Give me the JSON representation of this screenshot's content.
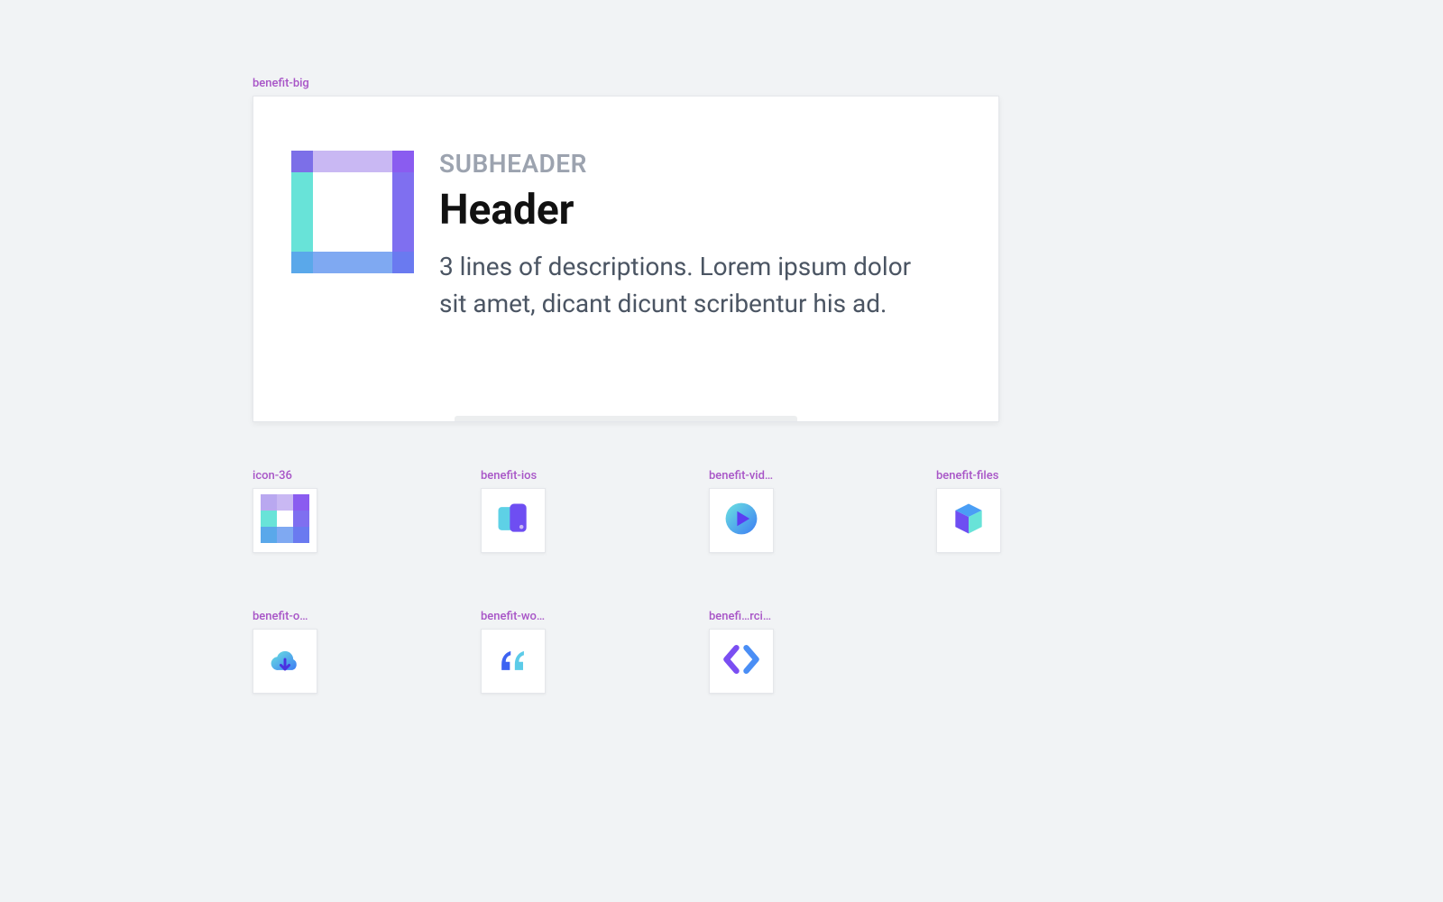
{
  "labels": {
    "benefit_big": "benefit-big",
    "icon_36": "icon-36",
    "benefit_ios": "benefit-ios",
    "benefit_video": "benefit-video",
    "benefit_files": "benefit-files",
    "benefit_offline": "benefit-offline",
    "benefit_words": "benefit-words",
    "benefit_exercises": "benefi…rcises"
  },
  "big": {
    "subheader": "SUBHEADER",
    "header": "Header",
    "description": "3 lines of descriptions. Lorem ipsum dolor sit amet, dicant dicunt scribentur his ad."
  },
  "icons": {
    "square_grid": "square-grid-icon",
    "pixel_grid": "pixel-grid-icon",
    "ios_cards": "ios-cards-icon",
    "play": "play-icon",
    "cube": "cube-icon",
    "cloud_download": "cloud-download-icon",
    "quotes": "quotes-icon",
    "code_brackets": "code-brackets-icon"
  }
}
